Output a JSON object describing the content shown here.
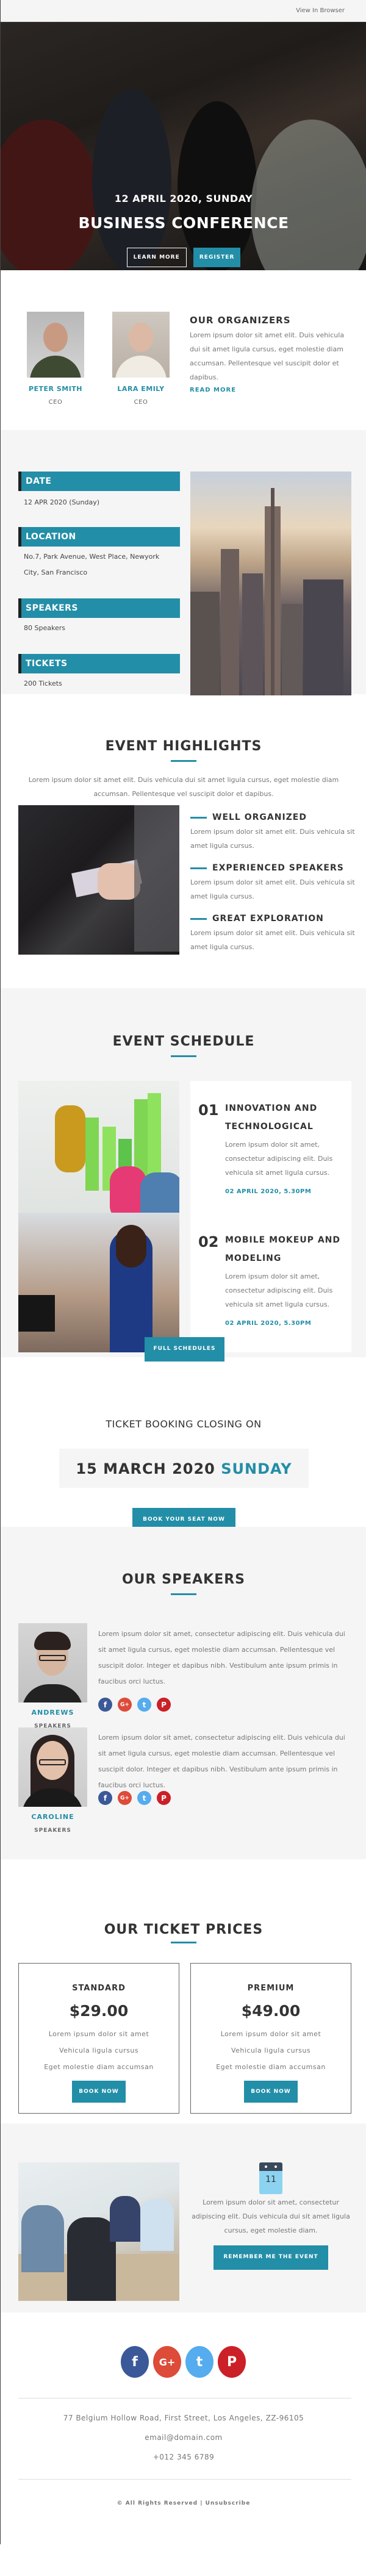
{
  "topbar": {
    "view_in_browser": "View In Browser"
  },
  "hero": {
    "date": "12 APRIL 2020, SUNDAY",
    "title": "BUSINESS CONFERENCE",
    "learn_more": "LEARN MORE",
    "register": "REGISTER"
  },
  "organizers": {
    "people": [
      {
        "name": "PETER SMITH",
        "role": "CEO"
      },
      {
        "name": "LARA EMILY",
        "role": "CEO"
      }
    ],
    "title": "OUR ORGANIZERS",
    "text": "Lorem ipsum dolor sit amet elit. Duis vehicula dui sit amet ligula cursus, eget molestie diam accumsan. Pellentesque vel suscipit dolor et dapibus.",
    "read_more": "READ MORE"
  },
  "info": {
    "items": [
      {
        "label": "DATE",
        "value": "12 APR 2020 (Sunday)"
      },
      {
        "label": "LOCATION",
        "value": "No.7, Park Avenue, West Place, Newyork City, San Francisco"
      },
      {
        "label": "SPEAKERS",
        "value": "80 Speakers"
      },
      {
        "label": "TICKETS",
        "value": "200 Tickets"
      }
    ]
  },
  "highlights": {
    "title": "EVENT HIGHLIGHTS",
    "intro": "Lorem ipsum dolor sit amet elit. Duis vehicula dui sit amet ligula cursus, eget molestie diam accumsan. Pellentesque vel suscipit dolor et dapibus.",
    "items": [
      {
        "title": "WELL ORGANIZED",
        "text": "Lorem ipsum dolor sit amet elit. Duis vehicula sit amet ligula cursus."
      },
      {
        "title": "EXPERIENCED SPEAKERS",
        "text": "Lorem ipsum dolor sit amet elit. Duis vehicula sit amet ligula cursus."
      },
      {
        "title": "GREAT EXPLORATION",
        "text": "Lorem ipsum dolor sit amet elit. Duis vehicula sit amet ligula cursus."
      }
    ]
  },
  "schedule": {
    "title": "EVENT SCHEDULE",
    "items": [
      {
        "number": "01",
        "title": "INNOVATION AND TECHNOLOGICAL",
        "text": "Lorem ipsum dolor sit amet, consectetur adipiscing elit. Duis vehicula sit amet ligula cursus.",
        "date": "02 APRIL 2020, 5.30PM"
      },
      {
        "number": "02",
        "title": "MOBILE MOKEUP AND MODELING",
        "text": "Lorem ipsum dolor sit amet, consectetur adipiscing elit. Duis vehicula sit amet ligula cursus.",
        "date": "02 APRIL 2020, 5.30PM"
      }
    ],
    "button": "FULL SCHEDULES"
  },
  "closing": {
    "label": "TICKET BOOKING CLOSING ON",
    "date": "15 MARCH 2020",
    "day": "SUNDAY",
    "button": "BOOK YOUR SEAT NOW"
  },
  "speakers": {
    "title": "OUR SPEAKERS",
    "items": [
      {
        "name": "ANDREWS",
        "role": "SPEAKERS",
        "bio": "Lorem ipsum dolor sit amet, consectetur adipiscing elit. Duis vehicula dui sit amet ligula cursus, eget molestie diam accumsan. Pellentesque vel suscipit dolor. Integer et dapibus nibh. Vestibulum ante ipsum primis in faucibus orci luctus."
      },
      {
        "name": "CAROLINE",
        "role": "SPEAKERS",
        "bio": "Lorem ipsum dolor sit amet, consectetur adipiscing elit. Duis vehicula dui sit amet ligula cursus, eget molestie diam accumsan. Pellentesque vel suscipit dolor. Integer et dapibus nibh. Vestibulum ante ipsum primis in faucibus orci luctus."
      }
    ],
    "social": [
      {
        "icon": "facebook-icon",
        "glyph": "f",
        "color": "#3b5998"
      },
      {
        "icon": "google-plus-icon",
        "glyph": "G+",
        "color": "#dd4b39"
      },
      {
        "icon": "twitter-icon",
        "glyph": "t",
        "color": "#55acee"
      },
      {
        "icon": "pinterest-icon",
        "glyph": "P",
        "color": "#cb2027"
      }
    ]
  },
  "prices": {
    "title": "OUR TICKET PRICES",
    "plans": [
      {
        "name": "STANDARD",
        "price": "$29.00",
        "features": [
          "Lorem ipsum dolor sit amet",
          "Vehicula ligula cursus",
          "Eget molestie diam accumsan"
        ],
        "button": "BOOK NOW"
      },
      {
        "name": "PREMIUM",
        "price": "$49.00",
        "features": [
          "Lorem ipsum dolor sit amet",
          "Vehicula ligula cursus",
          "Eget molestie diam accumsan"
        ],
        "button": "BOOK NOW"
      }
    ]
  },
  "remember": {
    "calendar_day": "11",
    "text": "Lorem ipsum dolor sit amet, consectetur adipiscing elit. Duis vehicula dui sit amet ligula cursus, eget molestie diam.",
    "button": "REMEMBER ME THE EVENT"
  },
  "footer": {
    "address": "77 Belgium Hollow Road, First Street, Los Angeles, ZZ-96105",
    "email": "email@domain.com",
    "phone": "+012 345 6789",
    "copyright": "© All Rights Reserved | Unsubscribe"
  },
  "colors": {
    "accent": "#238ea7",
    "section_gray": "#f5f5f5",
    "dark_text": "#333333"
  }
}
